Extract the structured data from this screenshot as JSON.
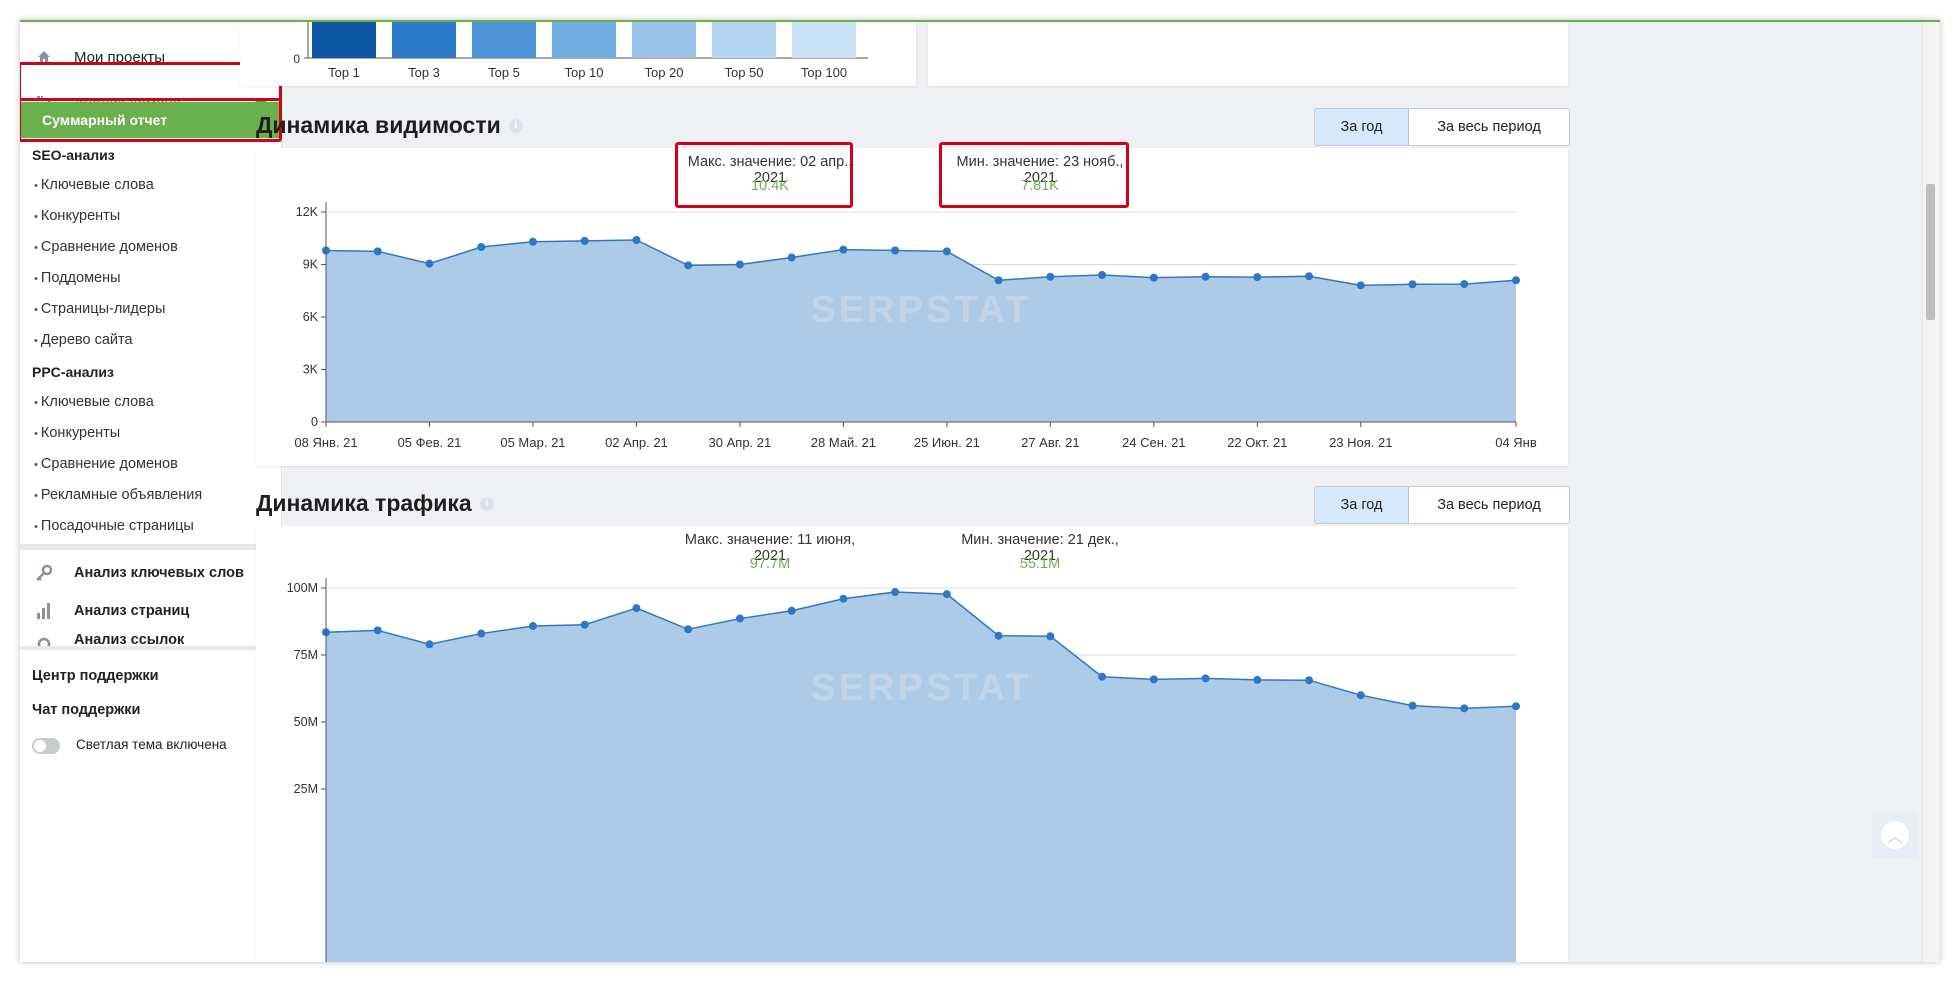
{
  "sidebar": {
    "my_projects": "Мои проекты",
    "domain_analysis": "Анализ домена",
    "summary_report": "Суммарный отчет",
    "seo_heading": "SEO-анализ",
    "seo_items": [
      "Ключевые слова",
      "Конкуренты",
      "Сравнение доменов",
      "Поддомены",
      "Страницы-лидеры",
      "Дерево сайта"
    ],
    "ppc_heading": "PPC-анализ",
    "ppc_items": [
      "Ключевые слова",
      "Конкуренты",
      "Сравнение доменов",
      "Рекламные объявления",
      "Посадочные страницы"
    ],
    "keyword_analysis": "Анализ ключевых слов",
    "page_analysis": "Анализ страниц",
    "link_analysis": "Анализ ссылок",
    "support_center": "Центр поддержки",
    "support_chat": "Чат поддержки",
    "theme_toggle": "Светлая тема включена"
  },
  "top_chart": {
    "chart_data": {
      "type": "bar",
      "categories": [
        "Top 1",
        "Top 3",
        "Top 5",
        "Top 10",
        "Top 20",
        "Top 50",
        "Top 100"
      ],
      "y_tick": "0",
      "colors": [
        "#0d57a3",
        "#2b7bc9",
        "#4d93d6",
        "#73aee3",
        "#9cc4ea",
        "#b5d4f0",
        "#c9e0f5"
      ]
    }
  },
  "visibility": {
    "title": "Динамика видимости",
    "btn_year": "За год",
    "btn_all": "За весь период",
    "max_label": "Макс. значение: 02 апр., 2021",
    "max_value": "10.4K",
    "min_label": "Мин. значение: 23 нояб., 2021",
    "min_value": "7.81K",
    "watermark": "SERPSTAT",
    "chart_data": {
      "type": "area",
      "ylim": [
        0,
        12000
      ],
      "y_ticks": [
        "0",
        "3K",
        "6K",
        "9K",
        "12K"
      ],
      "x_ticks": [
        "08 Янв. 21",
        "05 Фев. 21",
        "05 Мар. 21",
        "02 Апр. 21",
        "30 Апр. 21",
        "28 Май. 21",
        "25 Июн. 21",
        "27 Авг. 21",
        "24 Сен. 21",
        "22 Окт. 21",
        "23 Ноя. 21",
        "04 Янв"
      ],
      "series": [
        {
          "values": [
            9800,
            9750,
            9050,
            10000,
            10300,
            10350,
            10400,
            8950,
            9000,
            9400,
            9850,
            9800,
            9750,
            8100,
            8300,
            8400,
            8250,
            8300,
            8280,
            8330,
            7810,
            7870,
            7880,
            8100
          ]
        }
      ]
    }
  },
  "traffic": {
    "title": "Динамика трафика",
    "btn_year": "За год",
    "btn_all": "За весь период",
    "max_label": "Макс. значение: 11 июня, 2021",
    "max_value": "97.7M",
    "min_label": "Мин. значение: 21 дек., 2021",
    "min_value": "55.1M",
    "watermark": "SERPSTAT",
    "chart_data": {
      "type": "area",
      "ylim": [
        0,
        100
      ],
      "y_ticks": [
        "25M",
        "50M",
        "75M",
        "100M"
      ],
      "series": [
        {
          "values": [
            83.5,
            84.2,
            79.0,
            83.0,
            85.8,
            86.3,
            92.5,
            84.6,
            88.6,
            91.5,
            96.0,
            98.5,
            97.7,
            82.2,
            82.0,
            66.9,
            65.9,
            66.3,
            65.7,
            65.6,
            60.0,
            56.1,
            55.1,
            55.9
          ]
        }
      ]
    }
  }
}
